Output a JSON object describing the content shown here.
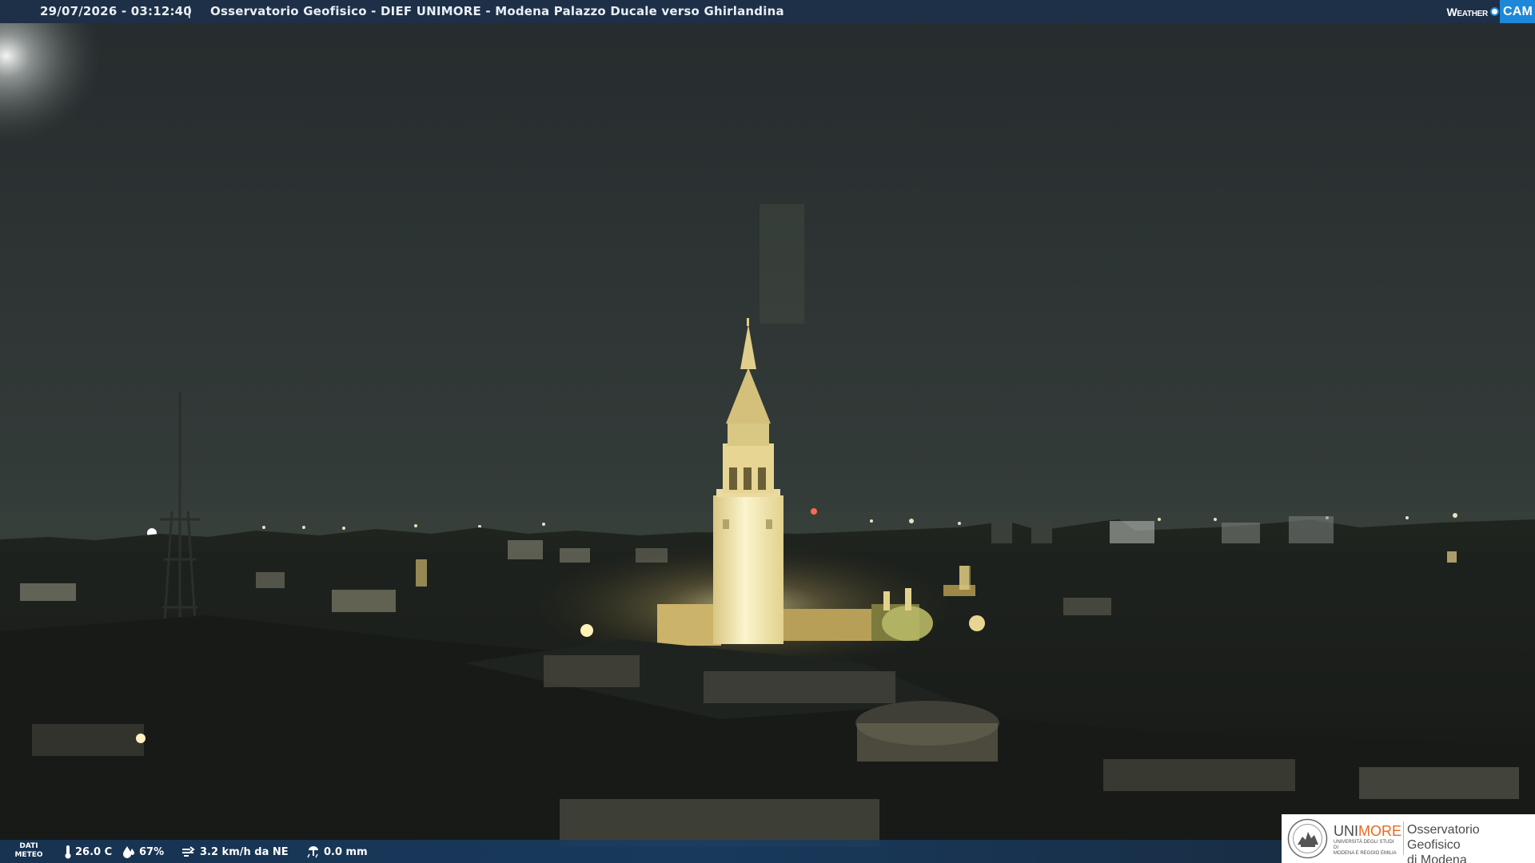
{
  "header": {
    "timestamp": "29/07/2026 - 03:12:40",
    "separator": "|",
    "title": "Osservatorio Geofisico - DIEF UNIMORE - Modena Palazzo Ducale verso Ghirlandina"
  },
  "brand": {
    "weather": "Weather",
    "cam": "CAM",
    "accent_color": "#1e88d8"
  },
  "weather_bar": {
    "caption_line1": "DATI",
    "caption_line2": "METEO",
    "temperature": "26.0 C",
    "humidity": "67%",
    "wind": "3.2 km/h da NE",
    "rain": "0.0 mm",
    "icons": [
      "thermometer-icon",
      "humidity-drop-icon",
      "wind-icon",
      "rain-gauge-icon"
    ]
  },
  "logo": {
    "unimore_part1": "UNI",
    "unimore_part2": "MORE",
    "university_line1": "UNIVERSITÀ DEGLI STUDI DI",
    "university_line2": "MODENA E REGGIO EMILIA",
    "observatory_line1": "Osservatorio Geofisico",
    "observatory_line2": "di Modena",
    "unimore_orange": "#e56a1e"
  },
  "scene": {
    "description_colors": {
      "sky_top": "#24292b",
      "sky_horizon": "#3b4540",
      "tower_light": "#f4e9b6"
    }
  }
}
